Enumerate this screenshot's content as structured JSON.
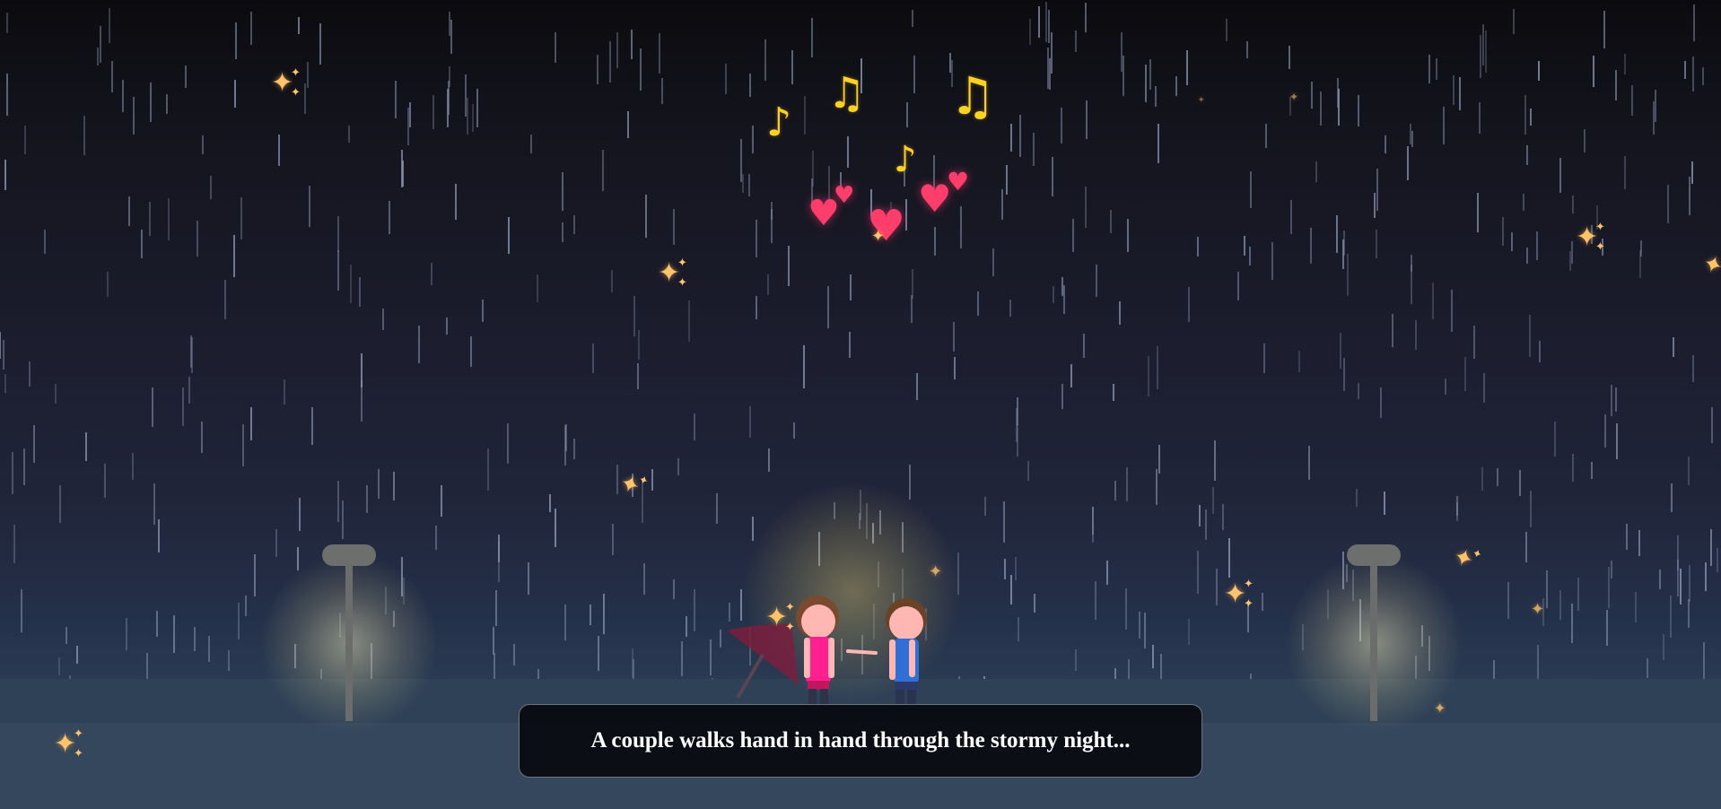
{
  "dialogue": {
    "text": "A couple walks hand in hand through the stormy night..."
  },
  "icons": {
    "notes": [
      "eighth-note",
      "beamed-notes",
      "beamed-notes",
      "eighth-note"
    ],
    "hearts": [
      "heart",
      "heart",
      "heart",
      "heart",
      "heart"
    ],
    "sparkle": "sparkle"
  },
  "colors": {
    "sky_top": "#0b0b0f",
    "sky_bottom": "#2a3a52",
    "ground": "#34475d",
    "rain": "#8a97b4",
    "note": "#ffd21f",
    "heart": "#ff3d6b",
    "sparkle": "#ffc36a",
    "girl_shirt": "#ff1f8f",
    "boy_shirt": "#2f6fd6",
    "umbrella": "#7a1f3d",
    "lamp": "#6d6f6d"
  }
}
